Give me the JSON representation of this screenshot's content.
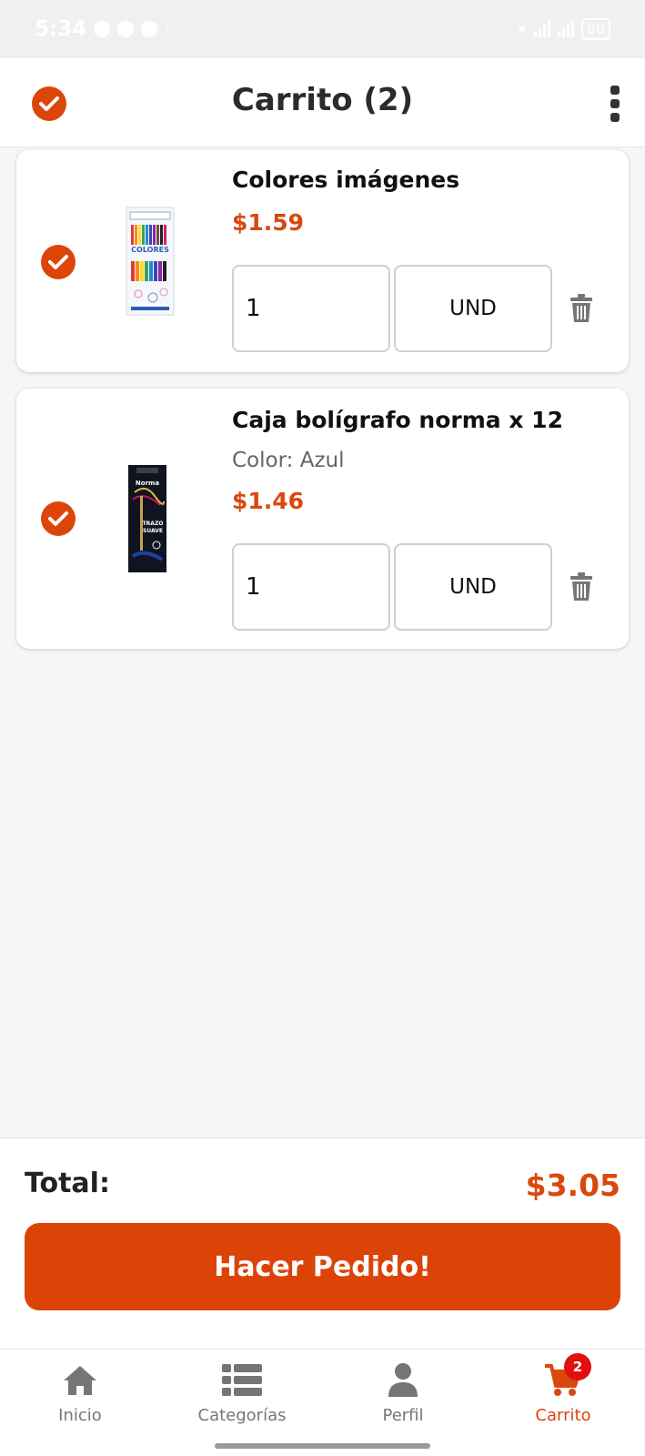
{
  "status_bar": {
    "time": "5:34",
    "battery": "80"
  },
  "header": {
    "title": "Carrito (2)"
  },
  "cart_items": [
    {
      "name": "Colores imágenes",
      "variant": "",
      "price": "$1.59",
      "quantity": "1",
      "unit": "UND",
      "image_icon": "colored-pencils-box-icon"
    },
    {
      "name": "Caja bolígrafo norma x 12",
      "variant": "Color: Azul",
      "price": "$1.46",
      "quantity": "1",
      "unit": "UND",
      "image_icon": "pen-box-icon"
    }
  ],
  "summary": {
    "total_label": "Total:",
    "total_value": "$3.05",
    "order_button": "Hacer Pedido!"
  },
  "bottom_nav": {
    "items": [
      {
        "label": "Inicio",
        "icon": "home-icon"
      },
      {
        "label": "Categorías",
        "icon": "list-icon"
      },
      {
        "label": "Perfil",
        "icon": "user-icon"
      },
      {
        "label": "Carrito",
        "icon": "cart-icon",
        "badge": "2",
        "active": true
      }
    ]
  },
  "colors": {
    "accent": "#dc4509",
    "price": "#d9480f",
    "badge": "#e01010"
  }
}
